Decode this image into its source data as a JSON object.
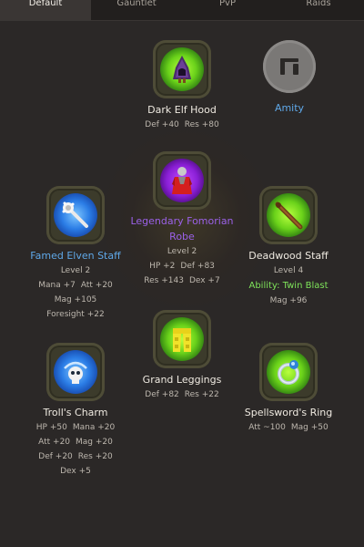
{
  "tabs": [
    {
      "label": "Default"
    },
    {
      "label": "Gauntlet"
    },
    {
      "label": "PvP"
    },
    {
      "label": "Raids"
    }
  ],
  "items": {
    "hood": {
      "name": "Dark Elf Hood",
      "stats": [
        "Def +40",
        "Res +80"
      ],
      "icon": "hood-icon"
    },
    "amity": {
      "name": "Amity",
      "icon": "amity-icon"
    },
    "robe": {
      "name_line1": "Legendary Fomorian",
      "name_line2": "Robe",
      "level": "Level 2",
      "stats": [
        "HP +2",
        "Def +83",
        "Res +143",
        "Dex +7"
      ],
      "icon": "robe-icon"
    },
    "staff_left": {
      "name": "Famed Elven Staff",
      "level": "Level 2",
      "stats": [
        "Mana +7",
        "Att +20",
        "Mag +105",
        "Foresight +22"
      ],
      "icon": "staff-icon"
    },
    "staff_right": {
      "name": "Deadwood Staff",
      "level": "Level 4",
      "ability": "Ability: Twin Blast",
      "stats": [
        "Mag +96"
      ],
      "icon": "wooden-staff-icon"
    },
    "leggings": {
      "name": "Grand Leggings",
      "stats": [
        "Def +82",
        "Res +22"
      ],
      "icon": "leggings-icon"
    },
    "charm": {
      "name": "Troll's Charm",
      "stats": [
        "HP +50",
        "Mana +20",
        "Att +20",
        "Mag +20",
        "Def +20",
        "Res +20",
        "Dex +5"
      ],
      "icon": "skull-charm-icon"
    },
    "ring": {
      "name": "Spellsword's Ring",
      "stats": [
        "Att ~100",
        "Mag +50"
      ],
      "icon": "ring-icon"
    }
  },
  "colors": {
    "background": "#2b2827",
    "legendary": "#9b61e8",
    "famed": "#5fa8e8",
    "ability": "#7ee35a"
  }
}
